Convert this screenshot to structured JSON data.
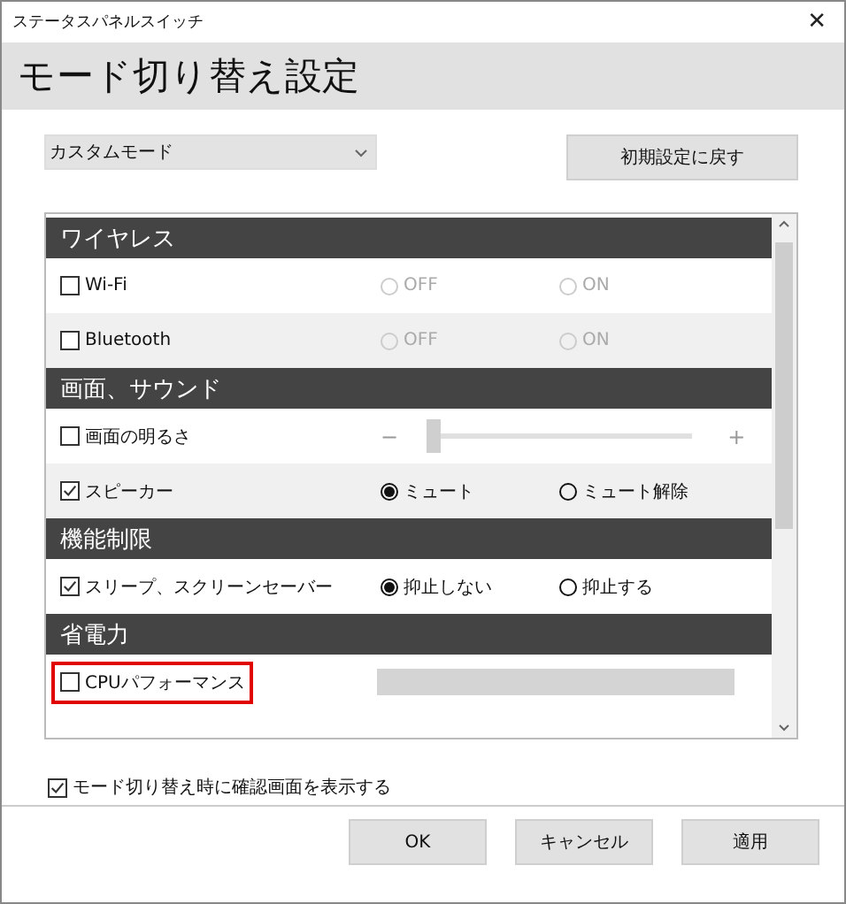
{
  "window": {
    "title": "ステータスパネルスイッチ",
    "close": "✕"
  },
  "header": {
    "title": "モード切り替え設定"
  },
  "mode_select": {
    "value": "カスタムモード"
  },
  "reset_button": "初期設定に戻す",
  "sections": [
    {
      "title": "ワイヤレス",
      "rows": [
        {
          "kind": "radio",
          "label": "Wi-Fi",
          "checked": false,
          "disabled": true,
          "highlighted": false,
          "options": [
            {
              "label": "OFF",
              "selected": false
            },
            {
              "label": "ON",
              "selected": false
            }
          ]
        },
        {
          "kind": "radio",
          "label": "Bluetooth",
          "checked": false,
          "disabled": true,
          "highlighted": false,
          "options": [
            {
              "label": "OFF",
              "selected": false
            },
            {
              "label": "ON",
              "selected": false
            }
          ]
        }
      ]
    },
    {
      "title": "画面、サウンド",
      "rows": [
        {
          "kind": "slider",
          "label": "画面の明るさ",
          "checked": false,
          "disabled": true,
          "highlighted": false,
          "level": 0.0,
          "minus": "−",
          "plus": "+"
        },
        {
          "kind": "radio",
          "label": "スピーカー",
          "checked": true,
          "disabled": false,
          "highlighted": false,
          "options": [
            {
              "label": "ミュート",
              "selected": true
            },
            {
              "label": "ミュート解除",
              "selected": false
            }
          ]
        }
      ]
    },
    {
      "title": "機能制限",
      "rows": [
        {
          "kind": "radio",
          "label": "スリープ、スクリーンセーバー",
          "checked": true,
          "disabled": false,
          "highlighted": false,
          "options": [
            {
              "label": "抑止しない",
              "selected": true
            },
            {
              "label": "抑止する",
              "selected": false
            }
          ]
        }
      ]
    },
    {
      "title": "省電力",
      "rows": [
        {
          "kind": "bar",
          "label": "CPUパフォーマンス",
          "checked": false,
          "disabled": true,
          "highlighted": true
        }
      ]
    }
  ],
  "confirm": {
    "label": "モード切り替え時に確認画面を表示する",
    "checked": true
  },
  "buttons": [
    "OK",
    "キャンセル",
    "適用"
  ]
}
